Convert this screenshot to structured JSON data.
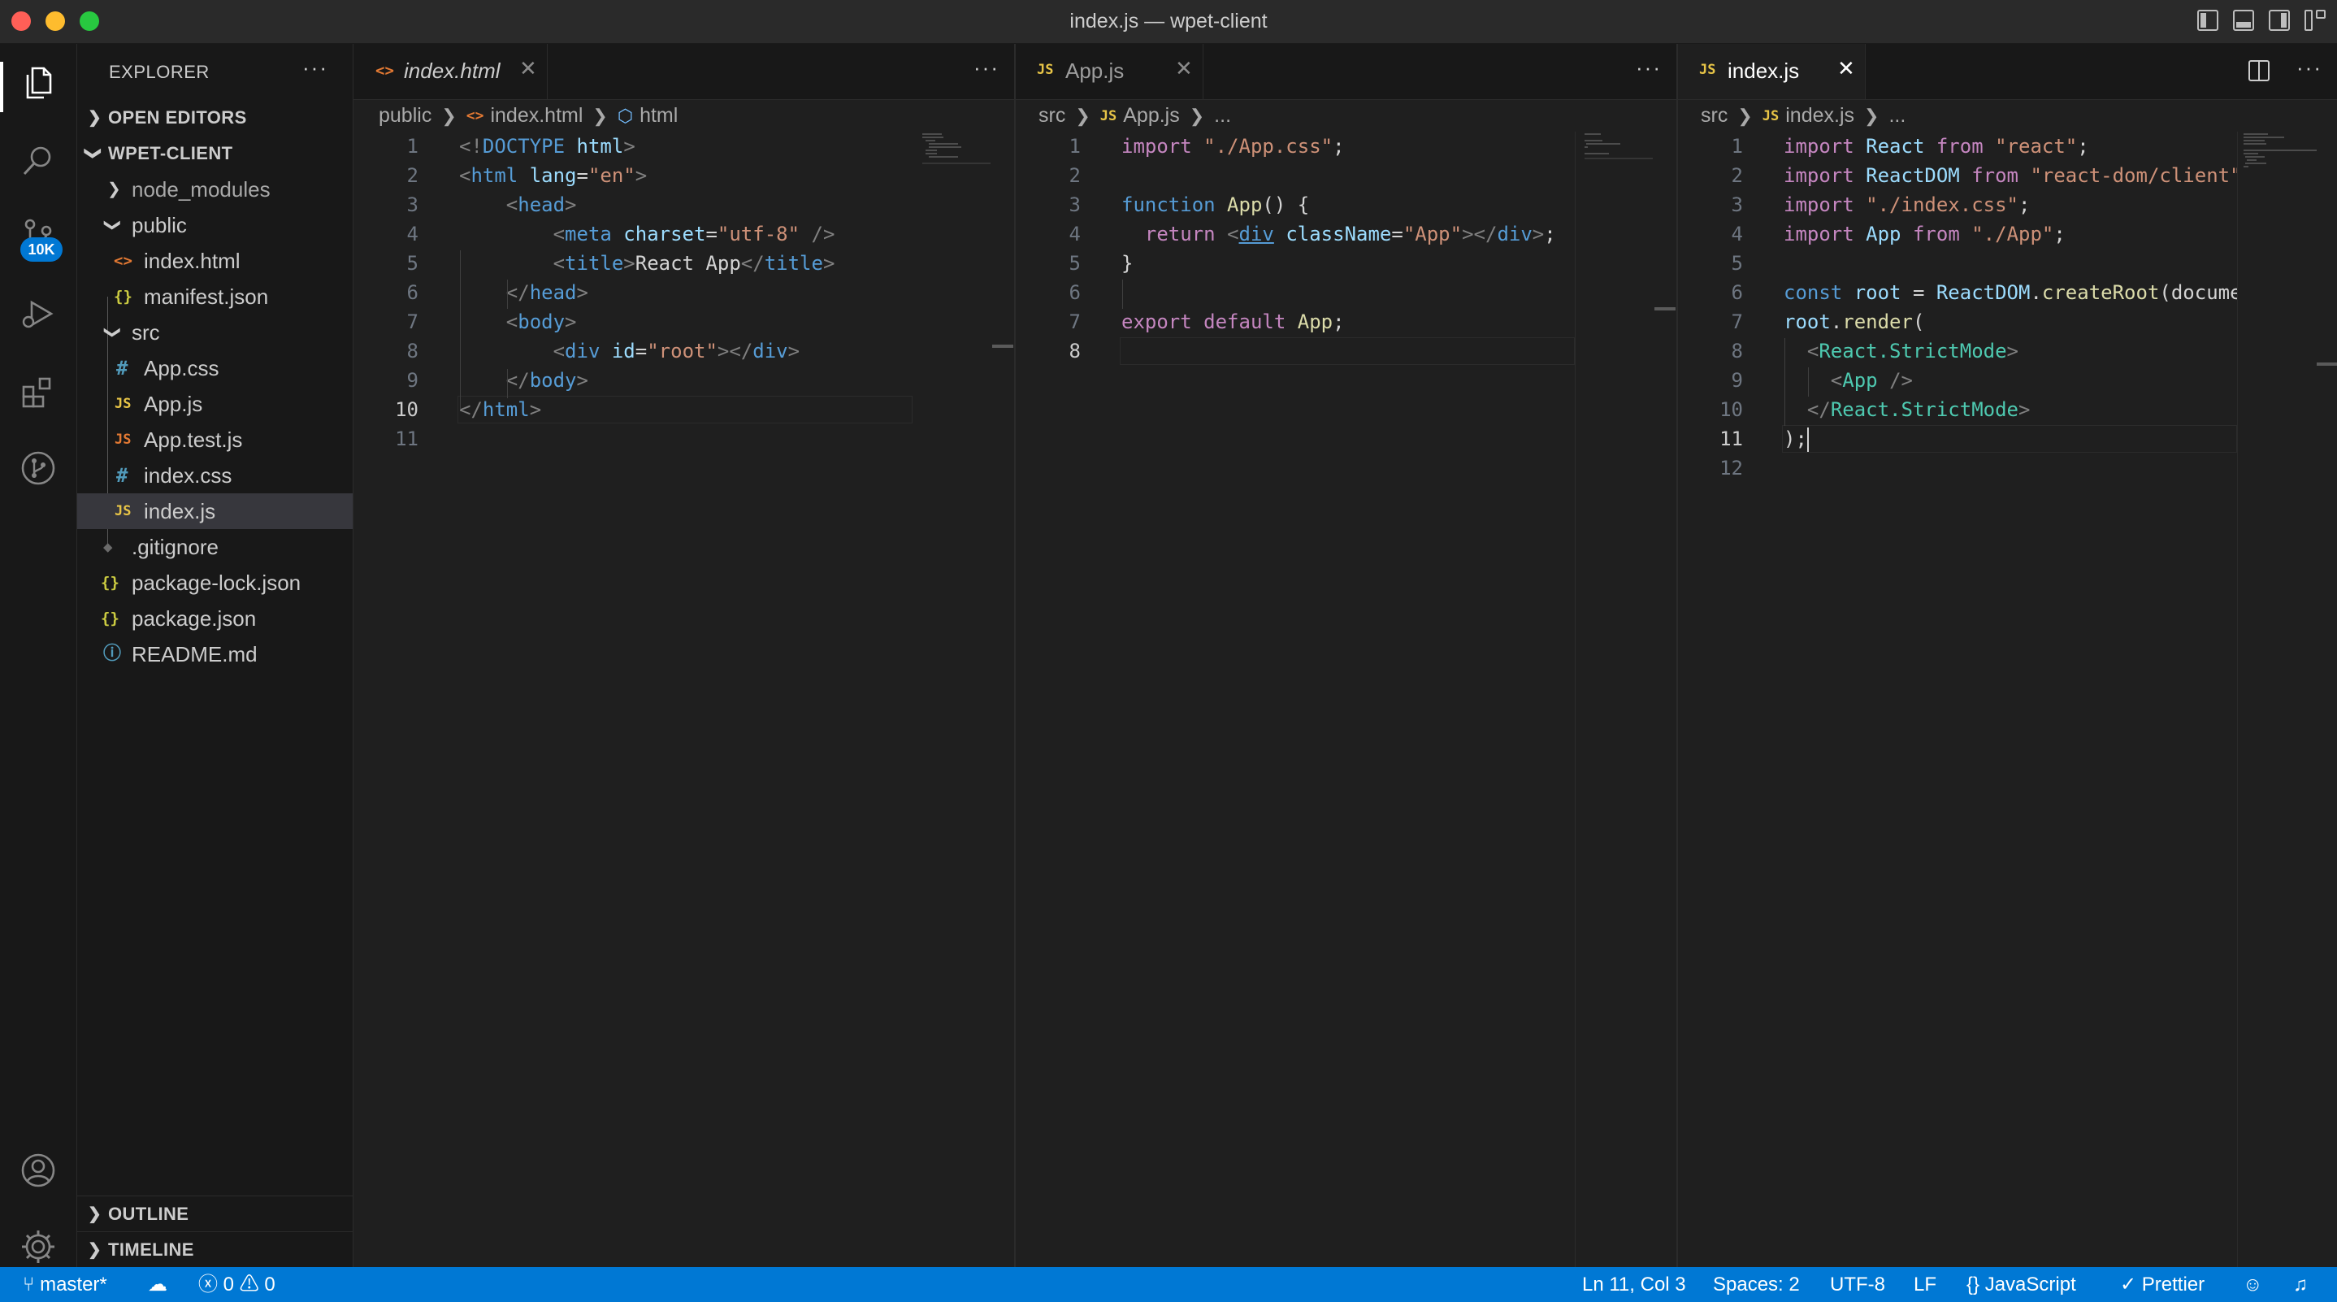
{
  "window": {
    "title": "index.js — wpet-client"
  },
  "activity_bar": {
    "source_control_badge": "10K"
  },
  "sidebar": {
    "title": "EXPLORER",
    "more": "···",
    "open_editors": "OPEN EDITORS",
    "project": "WPET-CLIENT",
    "outline": "OUTLINE",
    "timeline": "TIMELINE",
    "tree": [
      {
        "name": "node_modules",
        "type": "folder",
        "icon": "›"
      },
      {
        "name": "public",
        "type": "folder-open",
        "icon": "⌄"
      },
      {
        "name": "index.html",
        "type": "file",
        "icon": "<>"
      },
      {
        "name": "manifest.json",
        "type": "file",
        "icon": "{}"
      },
      {
        "name": "src",
        "type": "folder-open",
        "icon": "⌄"
      },
      {
        "name": "App.css",
        "type": "file",
        "icon": "#"
      },
      {
        "name": "App.js",
        "type": "file",
        "icon": "JS"
      },
      {
        "name": "App.test.js",
        "type": "file",
        "icon": "JS"
      },
      {
        "name": "index.css",
        "type": "file",
        "icon": "#"
      },
      {
        "name": "index.js",
        "type": "file",
        "icon": "JS"
      },
      {
        "name": ".gitignore",
        "type": "file",
        "icon": "◆"
      },
      {
        "name": "package-lock.json",
        "type": "file",
        "icon": "{}"
      },
      {
        "name": "package.json",
        "type": "file",
        "icon": "{}"
      },
      {
        "name": "README.md",
        "type": "file",
        "icon": "ⓘ"
      }
    ]
  },
  "editors": [
    {
      "tab": {
        "label": "index.html",
        "icon": "<>",
        "close": "✕"
      },
      "more": "···",
      "breadcrumb": [
        "public",
        "index.html",
        "html"
      ],
      "line_numbers": [
        "1",
        "2",
        "3",
        "4",
        "5",
        "6",
        "7",
        "8",
        "9",
        "10",
        "11"
      ],
      "active_line": 10
    },
    {
      "tab": {
        "label": "App.js",
        "icon": "JS",
        "close": "✕"
      },
      "more": "···",
      "breadcrumb": [
        "src",
        "App.js",
        "..."
      ],
      "line_numbers": [
        "1",
        "2",
        "3",
        "4",
        "5",
        "6",
        "7",
        "8"
      ],
      "active_line": 8
    },
    {
      "tab": {
        "label": "index.js",
        "icon": "JS",
        "close": "✕"
      },
      "more": "···",
      "breadcrumb": [
        "src",
        "index.js",
        "..."
      ],
      "line_numbers": [
        "1",
        "2",
        "3",
        "4",
        "5",
        "6",
        "7",
        "8",
        "9",
        "10",
        "11",
        "12"
      ],
      "active_line": 11
    }
  ],
  "code": {
    "html": [
      [
        [
          "k-punct",
          "<!"
        ],
        [
          "k-tag",
          "DOCTYPE"
        ],
        [
          "k-plain",
          " "
        ],
        [
          "k-attr",
          "html"
        ],
        [
          "k-punct",
          ">"
        ]
      ],
      [
        [
          "k-punct",
          "<"
        ],
        [
          "k-tag",
          "html"
        ],
        [
          "k-plain",
          " "
        ],
        [
          "k-attr",
          "lang"
        ],
        [
          "k-plain",
          "="
        ],
        [
          "k-str",
          "\"en\""
        ],
        [
          "k-punct",
          ">"
        ]
      ],
      [
        [
          "k-plain",
          "    "
        ],
        [
          "k-punct",
          "<"
        ],
        [
          "k-tag",
          "head"
        ],
        [
          "k-punct",
          ">"
        ]
      ],
      [
        [
          "k-plain",
          "        "
        ],
        [
          "k-punct",
          "<"
        ],
        [
          "k-tag",
          "meta"
        ],
        [
          "k-plain",
          " "
        ],
        [
          "k-attr",
          "charset"
        ],
        [
          "k-plain",
          "="
        ],
        [
          "k-str",
          "\"utf-8\""
        ],
        [
          "k-plain",
          " "
        ],
        [
          "k-punct",
          "/>"
        ]
      ],
      [
        [
          "k-plain",
          "        "
        ],
        [
          "k-punct",
          "<"
        ],
        [
          "k-tag",
          "title"
        ],
        [
          "k-punct",
          ">"
        ],
        [
          "k-plain",
          "React App"
        ],
        [
          "k-punct",
          "</"
        ],
        [
          "k-tag",
          "title"
        ],
        [
          "k-punct",
          ">"
        ]
      ],
      [
        [
          "k-plain",
          "    "
        ],
        [
          "k-punct",
          "</"
        ],
        [
          "k-tag",
          "head"
        ],
        [
          "k-punct",
          ">"
        ]
      ],
      [
        [
          "k-plain",
          "    "
        ],
        [
          "k-punct",
          "<"
        ],
        [
          "k-tag",
          "body"
        ],
        [
          "k-punct",
          ">"
        ]
      ],
      [
        [
          "k-plain",
          "        "
        ],
        [
          "k-punct",
          "<"
        ],
        [
          "k-tag",
          "div"
        ],
        [
          "k-plain",
          " "
        ],
        [
          "k-attr",
          "id"
        ],
        [
          "k-plain",
          "="
        ],
        [
          "k-str",
          "\"root\""
        ],
        [
          "k-punct",
          "></"
        ],
        [
          "k-tag",
          "div"
        ],
        [
          "k-punct",
          ">"
        ]
      ],
      [
        [
          "k-plain",
          "    "
        ],
        [
          "k-punct",
          "</"
        ],
        [
          "k-tag",
          "body"
        ],
        [
          "k-punct",
          ">"
        ]
      ],
      [
        [
          "k-punct",
          "</"
        ],
        [
          "k-tag",
          "html"
        ],
        [
          "k-punct",
          ">"
        ]
      ],
      []
    ],
    "appjs": [
      [
        [
          "k-kw",
          "import"
        ],
        [
          "k-plain",
          " "
        ],
        [
          "k-str",
          "\"./App.css\""
        ],
        [
          "k-plain",
          ";"
        ]
      ],
      [],
      [
        [
          "k-decl",
          "function"
        ],
        [
          "k-plain",
          " "
        ],
        [
          "k-fn",
          "App"
        ],
        [
          "k-plain",
          "() {"
        ]
      ],
      [
        [
          "k-plain",
          "  "
        ],
        [
          "k-kw",
          "return"
        ],
        [
          "k-plain",
          " "
        ],
        [
          "k-punct",
          "<"
        ],
        [
          "k-tag u",
          "div"
        ],
        [
          "k-plain",
          " "
        ],
        [
          "k-attr",
          "className"
        ],
        [
          "k-plain",
          "="
        ],
        [
          "k-str",
          "\"App\""
        ],
        [
          "k-punct",
          "></"
        ],
        [
          "k-tag",
          "div"
        ],
        [
          "k-punct",
          ">"
        ],
        [
          "k-plain",
          ";"
        ]
      ],
      [
        [
          "k-plain",
          "}"
        ]
      ],
      [],
      [
        [
          "k-kw",
          "export"
        ],
        [
          "k-plain",
          " "
        ],
        [
          "k-kw",
          "default"
        ],
        [
          "k-plain",
          " "
        ],
        [
          "k-fn",
          "App"
        ],
        [
          "k-plain",
          ";"
        ]
      ],
      []
    ],
    "indexjs": [
      [
        [
          "k-kw",
          "import"
        ],
        [
          "k-plain",
          " "
        ],
        [
          "k-var",
          "React"
        ],
        [
          "k-plain",
          " "
        ],
        [
          "k-kw",
          "from"
        ],
        [
          "k-plain",
          " "
        ],
        [
          "k-str",
          "\"react\""
        ],
        [
          "k-plain",
          ";"
        ]
      ],
      [
        [
          "k-kw",
          "import"
        ],
        [
          "k-plain",
          " "
        ],
        [
          "k-var",
          "ReactDOM"
        ],
        [
          "k-plain",
          " "
        ],
        [
          "k-kw",
          "from"
        ],
        [
          "k-plain",
          " "
        ],
        [
          "k-str",
          "\"react-dom/client\""
        ]
      ],
      [
        [
          "k-kw",
          "import"
        ],
        [
          "k-plain",
          " "
        ],
        [
          "k-str",
          "\"./index.css\""
        ],
        [
          "k-plain",
          ";"
        ]
      ],
      [
        [
          "k-kw",
          "import"
        ],
        [
          "k-plain",
          " "
        ],
        [
          "k-var",
          "App"
        ],
        [
          "k-plain",
          " "
        ],
        [
          "k-kw",
          "from"
        ],
        [
          "k-plain",
          " "
        ],
        [
          "k-str",
          "\"./App\""
        ],
        [
          "k-plain",
          ";"
        ]
      ],
      [],
      [
        [
          "k-decl",
          "const"
        ],
        [
          "k-plain",
          " "
        ],
        [
          "k-var",
          "root"
        ],
        [
          "k-plain",
          " = "
        ],
        [
          "k-var",
          "ReactDOM"
        ],
        [
          "k-plain",
          "."
        ],
        [
          "k-fn",
          "createRoot"
        ],
        [
          "k-plain",
          "(docume"
        ]
      ],
      [
        [
          "k-var",
          "root"
        ],
        [
          "k-plain",
          "."
        ],
        [
          "k-fn",
          "render"
        ],
        [
          "k-plain",
          "("
        ]
      ],
      [
        [
          "k-plain",
          "  "
        ],
        [
          "k-punct",
          "<"
        ],
        [
          "k-type",
          "React.StrictMode"
        ],
        [
          "k-punct",
          ">"
        ]
      ],
      [
        [
          "k-plain",
          "    "
        ],
        [
          "k-punct",
          "<"
        ],
        [
          "k-type",
          "App"
        ],
        [
          "k-plain",
          " "
        ],
        [
          "k-punct",
          "/>"
        ]
      ],
      [
        [
          "k-plain",
          "  "
        ],
        [
          "k-punct",
          "</"
        ],
        [
          "k-type",
          "React.StrictMode"
        ],
        [
          "k-punct",
          ">"
        ]
      ],
      [
        [
          "k-plain",
          ");"
        ]
      ],
      []
    ]
  },
  "statusbar": {
    "branch": "master*",
    "errors": "0",
    "warnings": "0",
    "position": "Ln 11, Col 3",
    "spaces": "Spaces: 2",
    "encoding": "UTF-8",
    "eol": "LF",
    "language": "JavaScript",
    "formatter": "Prettier"
  },
  "colors": {
    "statusbar": "#0078d4",
    "accent": "#0078d4",
    "editor_bg": "#1f1f1f",
    "sidebar_bg": "#181818"
  }
}
